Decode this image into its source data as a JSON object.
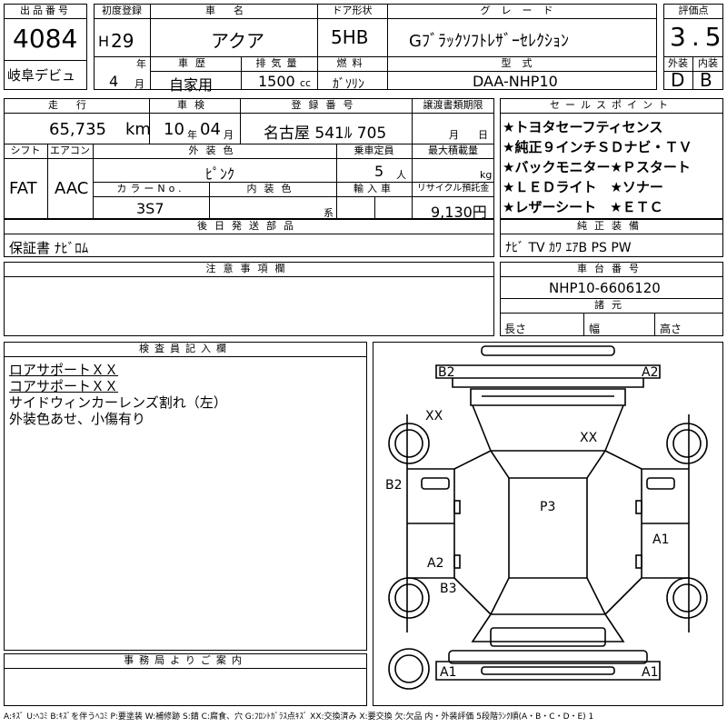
{
  "top": {
    "lot_label": "出品番号",
    "lot_number": "4084",
    "debut": "岐阜デビュ",
    "first_reg_label": "初度登録",
    "era": "H",
    "year": "29",
    "year_unit": "年",
    "month": "4",
    "month_unit": "月",
    "car_name_label": "車名",
    "car_name": "アクア",
    "door_label": "ドア形状",
    "door": "5HB",
    "grade_label": "グレード",
    "grade": "Gﾌﾞﾗｯｸｿﾌﾄﾚｻﾞｰｾﾚｸｼｮﾝ",
    "score_label": "評価点",
    "score": "3.5",
    "history_label": "車歴",
    "history": "自家用",
    "displacement_label": "排気量",
    "displacement": "1500",
    "displacement_unit": "cc",
    "fuel_label": "燃料",
    "fuel": "ｶﾞｿﾘﾝ",
    "model_label": "型式",
    "model": "DAA-NHP10",
    "ext_grade_label": "外装",
    "ext_grade": "D",
    "int_grade_label": "内装",
    "int_grade": "B"
  },
  "row2": {
    "mileage_label": "走行",
    "mileage": "65,735",
    "mileage_unit": "km",
    "inspection_label": "車検",
    "inspection_year": "10",
    "inspection_year_unit": "年",
    "inspection_month": "04",
    "inspection_month_unit": "月",
    "reg_no_label": "登録番号",
    "reg_no": "名古屋 541ﾙ 705",
    "transfer_label": "譲渡書類期限",
    "transfer_month_unit": "月",
    "transfer_day_unit": "日",
    "shift_label": "シフト",
    "shift": "FAT",
    "ac_label": "エアコン",
    "ac": "AAC",
    "exterior_color_label": "外装色",
    "exterior_color": "ﾋﾟﾝｸ",
    "capacity_label": "乗車定員",
    "capacity": "5",
    "capacity_unit": "人",
    "max_load_label": "最大積載量",
    "max_load_unit": "kg",
    "color_no_label": "カラーNo.",
    "color_no": "3S7",
    "interior_color_label": "内装色",
    "interior_color_unit": "系",
    "import_label": "輸入車",
    "recycle_label": "リサイクル預託金",
    "recycle": "9,130円"
  },
  "sales_points": {
    "label": "セールスポイント",
    "items": [
      "★トヨタセーフティセンス",
      "★純正９インチＳＤナビ・ＴＶ",
      "★バックモニター★Ｐスタート",
      "★ＬＥＤライト　★ソナー",
      "★レザーシート　★ＥＴＣ"
    ]
  },
  "later_parts": {
    "label": "後日発送部品",
    "value": "保証書 ﾅﾋﾞﾛﾑ"
  },
  "factory_equipment": {
    "label": "純正装備",
    "value": "ﾅﾋﾞ TV ｶﾜ ｴｱB PS PW"
  },
  "notes": {
    "label": "注意事項欄"
  },
  "chassis": {
    "label": "車台番号",
    "value": "NHP10-6606120"
  },
  "specs": {
    "label": "諸元",
    "length": "長さ",
    "width": "幅",
    "height": "高さ"
  },
  "inspector": {
    "label": "検査員記入欄",
    "lines": [
      "ロアサポートＸＸ",
      "コアサポートＸＸ",
      "サイドウィンカーレンズ割れ（左）",
      "外装色あせ、小傷有り"
    ]
  },
  "office": {
    "label": "事務局よりご案内"
  },
  "diagram": {
    "marks": {
      "b2_fr": "B2",
      "a2_fl": "A2",
      "xx_left": "XX",
      "xx_right": "XX",
      "b2_left": "B2",
      "p3": "P3",
      "a1_right": "A1",
      "a2_left": "A2",
      "b3_left": "B3",
      "a1_bl": "A1",
      "a1_br": "A1"
    }
  },
  "legend": "A:ｷｽﾞ U:ﾍｺﾐ B:ｷｽﾞを伴うﾍｺﾐ P:要塗装 W:補修跡 S:錆 C:腐食、穴 G:ﾌﾛﾝﾄｶﾞﾗｽ点ｷｽﾞ XX:交換済み X:要交換 欠:欠品 内・外装評価 5段階ﾗﾝｸ順(A・B・C・D・E) 1"
}
